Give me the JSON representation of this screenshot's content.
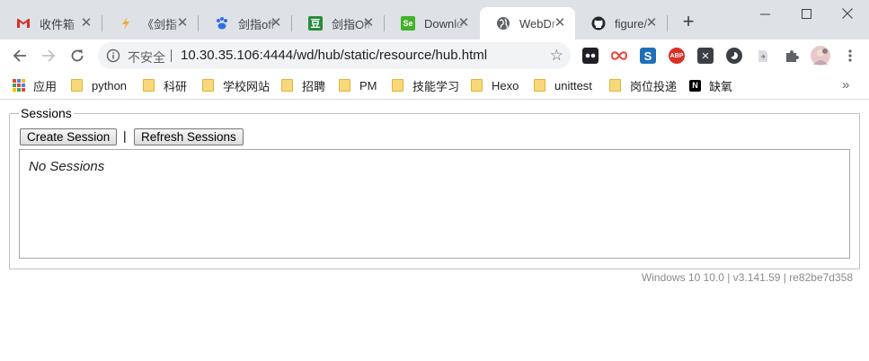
{
  "browser": {
    "tabs": [
      {
        "title": "收件箱",
        "icon": "gmail-icon",
        "active": false
      },
      {
        "title": "《剑指",
        "icon": "juejin-icon",
        "active": false
      },
      {
        "title": "剑指off",
        "icon": "baidu-paw-icon",
        "active": false
      },
      {
        "title": "剑指Off",
        "icon": "douban-icon",
        "active": false
      },
      {
        "title": "Downlo",
        "icon": "selenium-icon",
        "active": false
      },
      {
        "title": "WebDr",
        "icon": "globe-icon",
        "active": true
      },
      {
        "title": "figure/",
        "icon": "github-icon",
        "active": false
      }
    ],
    "address": {
      "security_label": "不安全",
      "url": "10.30.35.106:4444/wd/hub/static/resource/hub.html"
    },
    "bookmarks": [
      {
        "label": "应用",
        "type": "apps"
      },
      {
        "label": "python",
        "type": "folder"
      },
      {
        "label": "科研",
        "type": "folder"
      },
      {
        "label": "学校网站",
        "type": "folder"
      },
      {
        "label": "招聘",
        "type": "folder"
      },
      {
        "label": "PM",
        "type": "folder"
      },
      {
        "label": "技能学习",
        "type": "folder"
      },
      {
        "label": "Hexo",
        "type": "folder"
      },
      {
        "label": "unittest",
        "type": "folder"
      },
      {
        "label": "岗位投递",
        "type": "folder"
      },
      {
        "label": "缺氧",
        "type": "notion"
      }
    ]
  },
  "page": {
    "legend": "Sessions",
    "create_button": "Create Session",
    "separator": "|",
    "refresh_button": "Refresh Sessions",
    "empty_message": "No Sessions",
    "footer": "Windows 10 10.0  |  v3.141.59  |  re82be7d358"
  },
  "colors": {
    "tabstrip_bg": "#dee1e6",
    "omnibox_bg": "#f1f3f4",
    "folder_yellow": "#f9d879",
    "footer_text": "#8a8a8a"
  }
}
